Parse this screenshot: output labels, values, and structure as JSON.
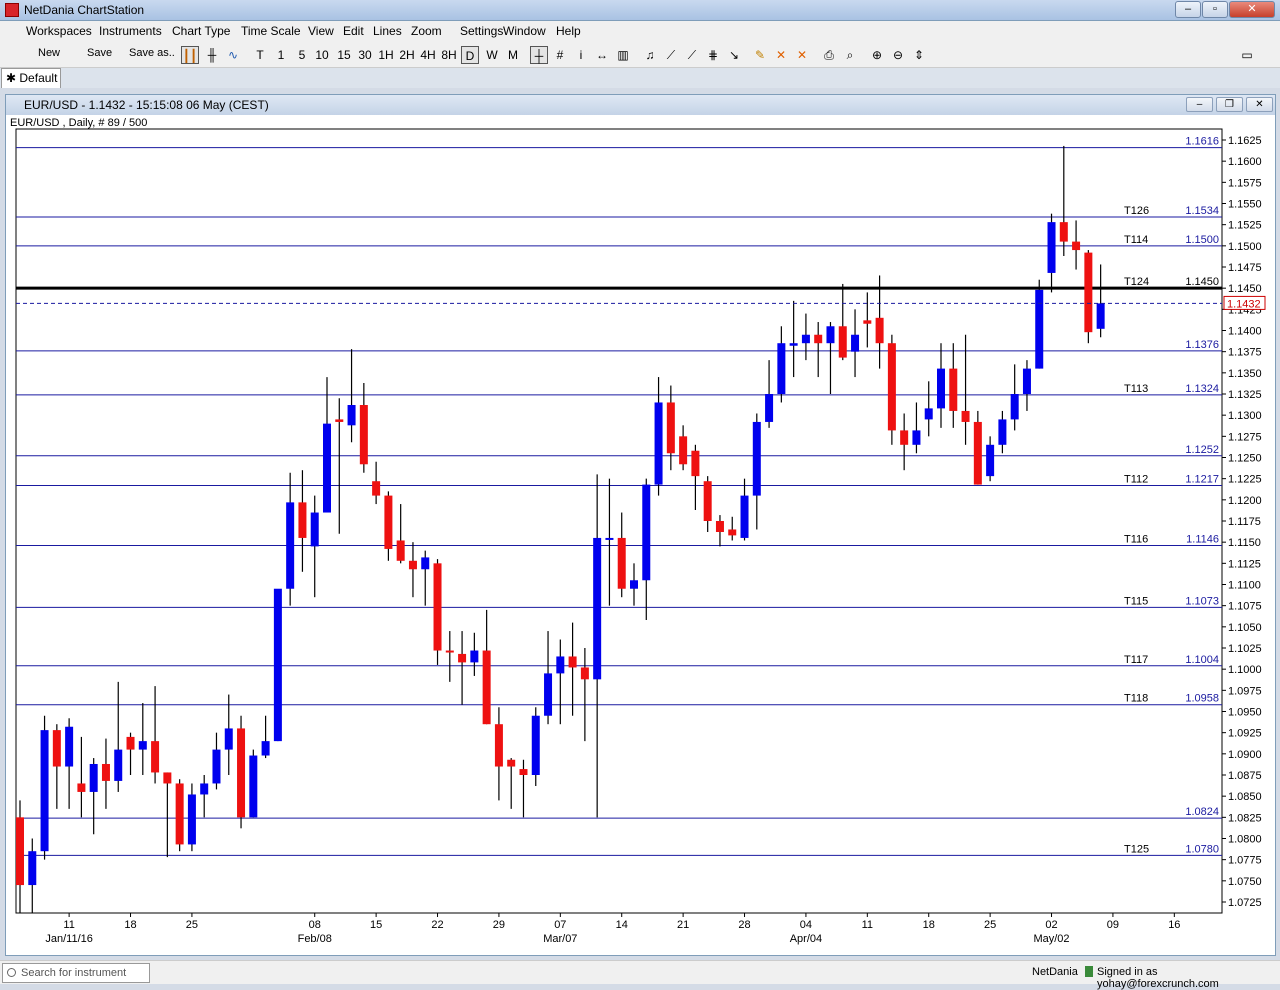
{
  "app": {
    "title": "NetDania ChartStation",
    "menu": [
      "Workspaces",
      "Instruments",
      "Chart Type",
      "Time Scale",
      "View",
      "Edit",
      "Lines",
      "Zoom",
      "Settings",
      "Window",
      "Help"
    ],
    "toolbar": {
      "new_label": "New",
      "save_label": "Save",
      "save_as_label": "Save as..",
      "timeframes": [
        "T",
        "1",
        "5",
        "10",
        "15",
        "30",
        "1H",
        "2H",
        "4H",
        "8H",
        "D",
        "W",
        "M"
      ],
      "active_timeframe": "D"
    },
    "tab": "Default"
  },
  "chart_window": {
    "title": "EUR/USD - 1.1432 - 15:15:08  06 May (CEST)",
    "info": "EUR/USD , Daily, # 89 / 500"
  },
  "chart_data": {
    "type": "candlestick",
    "instrument": "EUR/USD",
    "ylim": [
      1.0712,
      1.1638
    ],
    "y_ticks": [
      1.0725,
      1.075,
      1.0775,
      1.08,
      1.0825,
      1.085,
      1.0875,
      1.09,
      1.0925,
      1.095,
      1.0975,
      1.1,
      1.1025,
      1.105,
      1.1075,
      1.11,
      1.1125,
      1.115,
      1.1175,
      1.12,
      1.1225,
      1.125,
      1.1275,
      1.13,
      1.1325,
      1.135,
      1.1375,
      1.14,
      1.1425,
      1.145,
      1.1475,
      1.15,
      1.1525,
      1.155,
      1.1575,
      1.16,
      1.1625
    ],
    "x_ticks": [
      {
        "label": "11",
        "i": 4
      },
      {
        "label": "18",
        "i": 9
      },
      {
        "label": "25",
        "i": 14
      },
      {
        "label": "08",
        "i": 24
      },
      {
        "label": "15",
        "i": 29
      },
      {
        "label": "22",
        "i": 34
      },
      {
        "label": "29",
        "i": 39
      },
      {
        "label": "07",
        "i": 44
      },
      {
        "label": "14",
        "i": 49
      },
      {
        "label": "21",
        "i": 54
      },
      {
        "label": "28",
        "i": 59
      },
      {
        "label": "04",
        "i": 64
      },
      {
        "label": "11",
        "i": 69
      },
      {
        "label": "18",
        "i": 74
      },
      {
        "label": "25",
        "i": 79
      },
      {
        "label": "02",
        "i": 84
      },
      {
        "label": "09",
        "i": 89
      },
      {
        "label": "16",
        "i": 94
      }
    ],
    "x_month_labels": [
      {
        "label": "Jan/11/16",
        "i": 4
      },
      {
        "label": "Feb/08",
        "i": 24
      },
      {
        "label": "Mar/07",
        "i": 44
      },
      {
        "label": "Apr/04",
        "i": 64
      },
      {
        "label": "May/02",
        "i": 84
      }
    ],
    "candles": [
      {
        "o": 1.0825,
        "h": 1.0845,
        "l": 1.0712,
        "c": 1.0745
      },
      {
        "o": 1.0745,
        "h": 1.08,
        "l": 1.0712,
        "c": 1.0785
      },
      {
        "o": 1.0785,
        "h": 1.0945,
        "l": 1.0775,
        "c": 1.0928
      },
      {
        "o": 1.0928,
        "h": 1.0935,
        "l": 1.0835,
        "c": 1.0885
      },
      {
        "o": 1.0885,
        "h": 1.0942,
        "l": 1.0835,
        "c": 1.0932
      },
      {
        "o": 1.0865,
        "h": 1.092,
        "l": 1.0825,
        "c": 1.0855
      },
      {
        "o": 1.0855,
        "h": 1.0895,
        "l": 1.0805,
        "c": 1.0888
      },
      {
        "o": 1.0888,
        "h": 1.0918,
        "l": 1.0835,
        "c": 1.0868
      },
      {
        "o": 1.0868,
        "h": 1.0985,
        "l": 1.0855,
        "c": 1.0905
      },
      {
        "o": 1.092,
        "h": 1.0925,
        "l": 1.0875,
        "c": 1.0905
      },
      {
        "o": 1.0905,
        "h": 1.096,
        "l": 1.0875,
        "c": 1.0915
      },
      {
        "o": 1.0915,
        "h": 1.098,
        "l": 1.0865,
        "c": 1.0878
      },
      {
        "o": 1.0878,
        "h": 1.0878,
        "l": 1.0778,
        "c": 1.0865
      },
      {
        "o": 1.0865,
        "h": 1.087,
        "l": 1.0785,
        "c": 1.0793
      },
      {
        "o": 1.0793,
        "h": 1.0865,
        "l": 1.0785,
        "c": 1.0852
      },
      {
        "o": 1.0852,
        "h": 1.0875,
        "l": 1.0825,
        "c": 1.0865
      },
      {
        "o": 1.0865,
        "h": 1.0925,
        "l": 1.0858,
        "c": 1.0905
      },
      {
        "o": 1.0905,
        "h": 1.097,
        "l": 1.0875,
        "c": 1.093
      },
      {
        "o": 1.093,
        "h": 1.0945,
        "l": 1.0812,
        "c": 1.0825
      },
      {
        "o": 1.0825,
        "h": 1.0905,
        "l": 1.0825,
        "c": 1.0898
      },
      {
        "o": 1.0898,
        "h": 1.0945,
        "l": 1.0895,
        "c": 1.0915
      },
      {
        "o": 1.0915,
        "h": 1.1075,
        "l": 1.0915,
        "c": 1.1095
      },
      {
        "o": 1.1095,
        "h": 1.1232,
        "l": 1.1075,
        "c": 1.1197
      },
      {
        "o": 1.1197,
        "h": 1.1235,
        "l": 1.1115,
        "c": 1.1155
      },
      {
        "o": 1.1145,
        "h": 1.1205,
        "l": 1.1085,
        "c": 1.1185
      },
      {
        "o": 1.1185,
        "h": 1.1345,
        "l": 1.1185,
        "c": 1.129
      },
      {
        "o": 1.1295,
        "h": 1.132,
        "l": 1.116,
        "c": 1.1292
      },
      {
        "o": 1.1288,
        "h": 1.1378,
        "l": 1.1268,
        "c": 1.1312
      },
      {
        "o": 1.1312,
        "h": 1.1338,
        "l": 1.1232,
        "c": 1.1242
      },
      {
        "o": 1.1222,
        "h": 1.1245,
        "l": 1.1195,
        "c": 1.1205
      },
      {
        "o": 1.1205,
        "h": 1.121,
        "l": 1.1128,
        "c": 1.1142
      },
      {
        "o": 1.1152,
        "h": 1.1195,
        "l": 1.1125,
        "c": 1.1128
      },
      {
        "o": 1.1128,
        "h": 1.115,
        "l": 1.1085,
        "c": 1.1118
      },
      {
        "o": 1.1118,
        "h": 1.114,
        "l": 1.1075,
        "c": 1.1132
      },
      {
        "o": 1.1125,
        "h": 1.113,
        "l": 1.1005,
        "c": 1.1022
      },
      {
        "o": 1.1022,
        "h": 1.1045,
        "l": 1.0985,
        "c": 1.102
      },
      {
        "o": 1.1018,
        "h": 1.1045,
        "l": 1.0958,
        "c": 1.1008
      },
      {
        "o": 1.1008,
        "h": 1.1043,
        "l": 1.0992,
        "c": 1.1022
      },
      {
        "o": 1.1022,
        "h": 1.107,
        "l": 1.0935,
        "c": 1.0935
      },
      {
        "o": 1.0935,
        "h": 1.0955,
        "l": 1.0845,
        "c": 1.0885
      },
      {
        "o": 1.0893,
        "h": 1.0895,
        "l": 1.0835,
        "c": 1.0885
      },
      {
        "o": 1.0882,
        "h": 1.0893,
        "l": 1.0825,
        "c": 1.0875
      },
      {
        "o": 1.0875,
        "h": 1.0955,
        "l": 1.0862,
        "c": 1.0945
      },
      {
        "o": 1.0945,
        "h": 1.1045,
        "l": 1.0935,
        "c": 1.0995
      },
      {
        "o": 1.0995,
        "h": 1.1035,
        "l": 1.0935,
        "c": 1.1015
      },
      {
        "o": 1.1015,
        "h": 1.1055,
        "l": 1.0945,
        "c": 1.1002
      },
      {
        "o": 1.1002,
        "h": 1.1025,
        "l": 1.0915,
        "c": 1.0988
      },
      {
        "o": 1.0988,
        "h": 1.123,
        "l": 1.0825,
        "c": 1.1155
      },
      {
        "o": 1.1155,
        "h": 1.1225,
        "l": 1.1075,
        "c": 1.1155
      },
      {
        "o": 1.1155,
        "h": 1.1185,
        "l": 1.1085,
        "c": 1.1095
      },
      {
        "o": 1.1095,
        "h": 1.1125,
        "l": 1.1075,
        "c": 1.1105
      },
      {
        "o": 1.1105,
        "h": 1.1225,
        "l": 1.1058,
        "c": 1.1218
      },
      {
        "o": 1.1218,
        "h": 1.1345,
        "l": 1.1205,
        "c": 1.1315
      },
      {
        "o": 1.1315,
        "h": 1.1335,
        "l": 1.1235,
        "c": 1.1255
      },
      {
        "o": 1.1275,
        "h": 1.1288,
        "l": 1.1235,
        "c": 1.1242
      },
      {
        "o": 1.1258,
        "h": 1.1265,
        "l": 1.1188,
        "c": 1.1228
      },
      {
        "o": 1.1222,
        "h": 1.1228,
        "l": 1.1162,
        "c": 1.1175
      },
      {
        "o": 1.1175,
        "h": 1.1182,
        "l": 1.1145,
        "c": 1.1162
      },
      {
        "o": 1.1165,
        "h": 1.118,
        "l": 1.1152,
        "c": 1.1158
      },
      {
        "o": 1.1155,
        "h": 1.1225,
        "l": 1.1152,
        "c": 1.1205
      },
      {
        "o": 1.1205,
        "h": 1.1302,
        "l": 1.1165,
        "c": 1.1292
      },
      {
        "o": 1.1292,
        "h": 1.1365,
        "l": 1.1285,
        "c": 1.1325
      },
      {
        "o": 1.1325,
        "h": 1.1405,
        "l": 1.1315,
        "c": 1.1385
      },
      {
        "o": 1.1382,
        "h": 1.1435,
        "l": 1.1345,
        "c": 1.1385
      },
      {
        "o": 1.1385,
        "h": 1.142,
        "l": 1.1365,
        "c": 1.1395
      },
      {
        "o": 1.1395,
        "h": 1.141,
        "l": 1.1345,
        "c": 1.1385
      },
      {
        "o": 1.1385,
        "h": 1.141,
        "l": 1.1325,
        "c": 1.1405
      },
      {
        "o": 1.1405,
        "h": 1.1455,
        "l": 1.1365,
        "c": 1.1368
      },
      {
        "o": 1.1375,
        "h": 1.1425,
        "l": 1.1345,
        "c": 1.1395
      },
      {
        "o": 1.1412,
        "h": 1.1445,
        "l": 1.138,
        "c": 1.1408
      },
      {
        "o": 1.1415,
        "h": 1.1465,
        "l": 1.1355,
        "c": 1.1385
      },
      {
        "o": 1.1385,
        "h": 1.1395,
        "l": 1.1265,
        "c": 1.1282
      },
      {
        "o": 1.1282,
        "h": 1.1302,
        "l": 1.1235,
        "c": 1.1265
      },
      {
        "o": 1.1265,
        "h": 1.1315,
        "l": 1.1255,
        "c": 1.1282
      },
      {
        "o": 1.1295,
        "h": 1.134,
        "l": 1.1275,
        "c": 1.1308
      },
      {
        "o": 1.1308,
        "h": 1.1385,
        "l": 1.1285,
        "c": 1.1355
      },
      {
        "o": 1.1355,
        "h": 1.1385,
        "l": 1.1285,
        "c": 1.1305
      },
      {
        "o": 1.1305,
        "h": 1.1395,
        "l": 1.1265,
        "c": 1.1292
      },
      {
        "o": 1.1292,
        "h": 1.1305,
        "l": 1.1218,
        "c": 1.1218
      },
      {
        "o": 1.1228,
        "h": 1.1275,
        "l": 1.1222,
        "c": 1.1265
      },
      {
        "o": 1.1265,
        "h": 1.1305,
        "l": 1.1255,
        "c": 1.1295
      },
      {
        "o": 1.1295,
        "h": 1.136,
        "l": 1.1282,
        "c": 1.1325
      },
      {
        "o": 1.1325,
        "h": 1.1365,
        "l": 1.1305,
        "c": 1.1355
      },
      {
        "o": 1.1355,
        "h": 1.146,
        "l": 1.1355,
        "c": 1.1448
      },
      {
        "o": 1.1468,
        "h": 1.1538,
        "l": 1.1445,
        "c": 1.1528
      },
      {
        "o": 1.1528,
        "h": 1.1618,
        "l": 1.1488,
        "c": 1.1505
      },
      {
        "o": 1.1505,
        "h": 1.153,
        "l": 1.1472,
        "c": 1.1495
      },
      {
        "o": 1.1492,
        "h": 1.1495,
        "l": 1.1385,
        "c": 1.1398
      },
      {
        "o": 1.1402,
        "h": 1.1478,
        "l": 1.1392,
        "c": 1.1432
      }
    ],
    "horizontal_lines": [
      {
        "value": 1.1616,
        "label": "",
        "value_label": "1.1616"
      },
      {
        "value": 1.1534,
        "label": "T126",
        "value_label": "1.1534"
      },
      {
        "value": 1.15,
        "label": "T114",
        "value_label": "1.1500"
      },
      {
        "value": 1.145,
        "label": "T124",
        "value_label": "1.1450",
        "style": "bold"
      },
      {
        "value": 1.1376,
        "label": "",
        "value_label": "1.1376"
      },
      {
        "value": 1.1324,
        "label": "T113",
        "value_label": "1.1324"
      },
      {
        "value": 1.1252,
        "label": "",
        "value_label": "1.1252"
      },
      {
        "value": 1.1217,
        "label": "T112",
        "value_label": "1.1217"
      },
      {
        "value": 1.1146,
        "label": "T116",
        "value_label": "1.1146"
      },
      {
        "value": 1.1073,
        "label": "T115",
        "value_label": "1.1073"
      },
      {
        "value": 1.1004,
        "label": "T117",
        "value_label": "1.1004"
      },
      {
        "value": 1.0958,
        "label": "T118",
        "value_label": "1.0958"
      },
      {
        "value": 1.0824,
        "label": "",
        "value_label": "1.0824"
      },
      {
        "value": 1.078,
        "label": "T125",
        "value_label": "1.0780"
      }
    ],
    "current_price": {
      "value": 1.1432,
      "label": "1.1432"
    },
    "colors": {
      "up": "#0000ee",
      "down": "#ee1111",
      "line": "#1a1aa0",
      "current": "#cc0000"
    }
  },
  "status": {
    "search_placeholder": "Search for instrument",
    "brand": "NetDania",
    "user": "Signed in as yohay@forexcrunch.com"
  }
}
